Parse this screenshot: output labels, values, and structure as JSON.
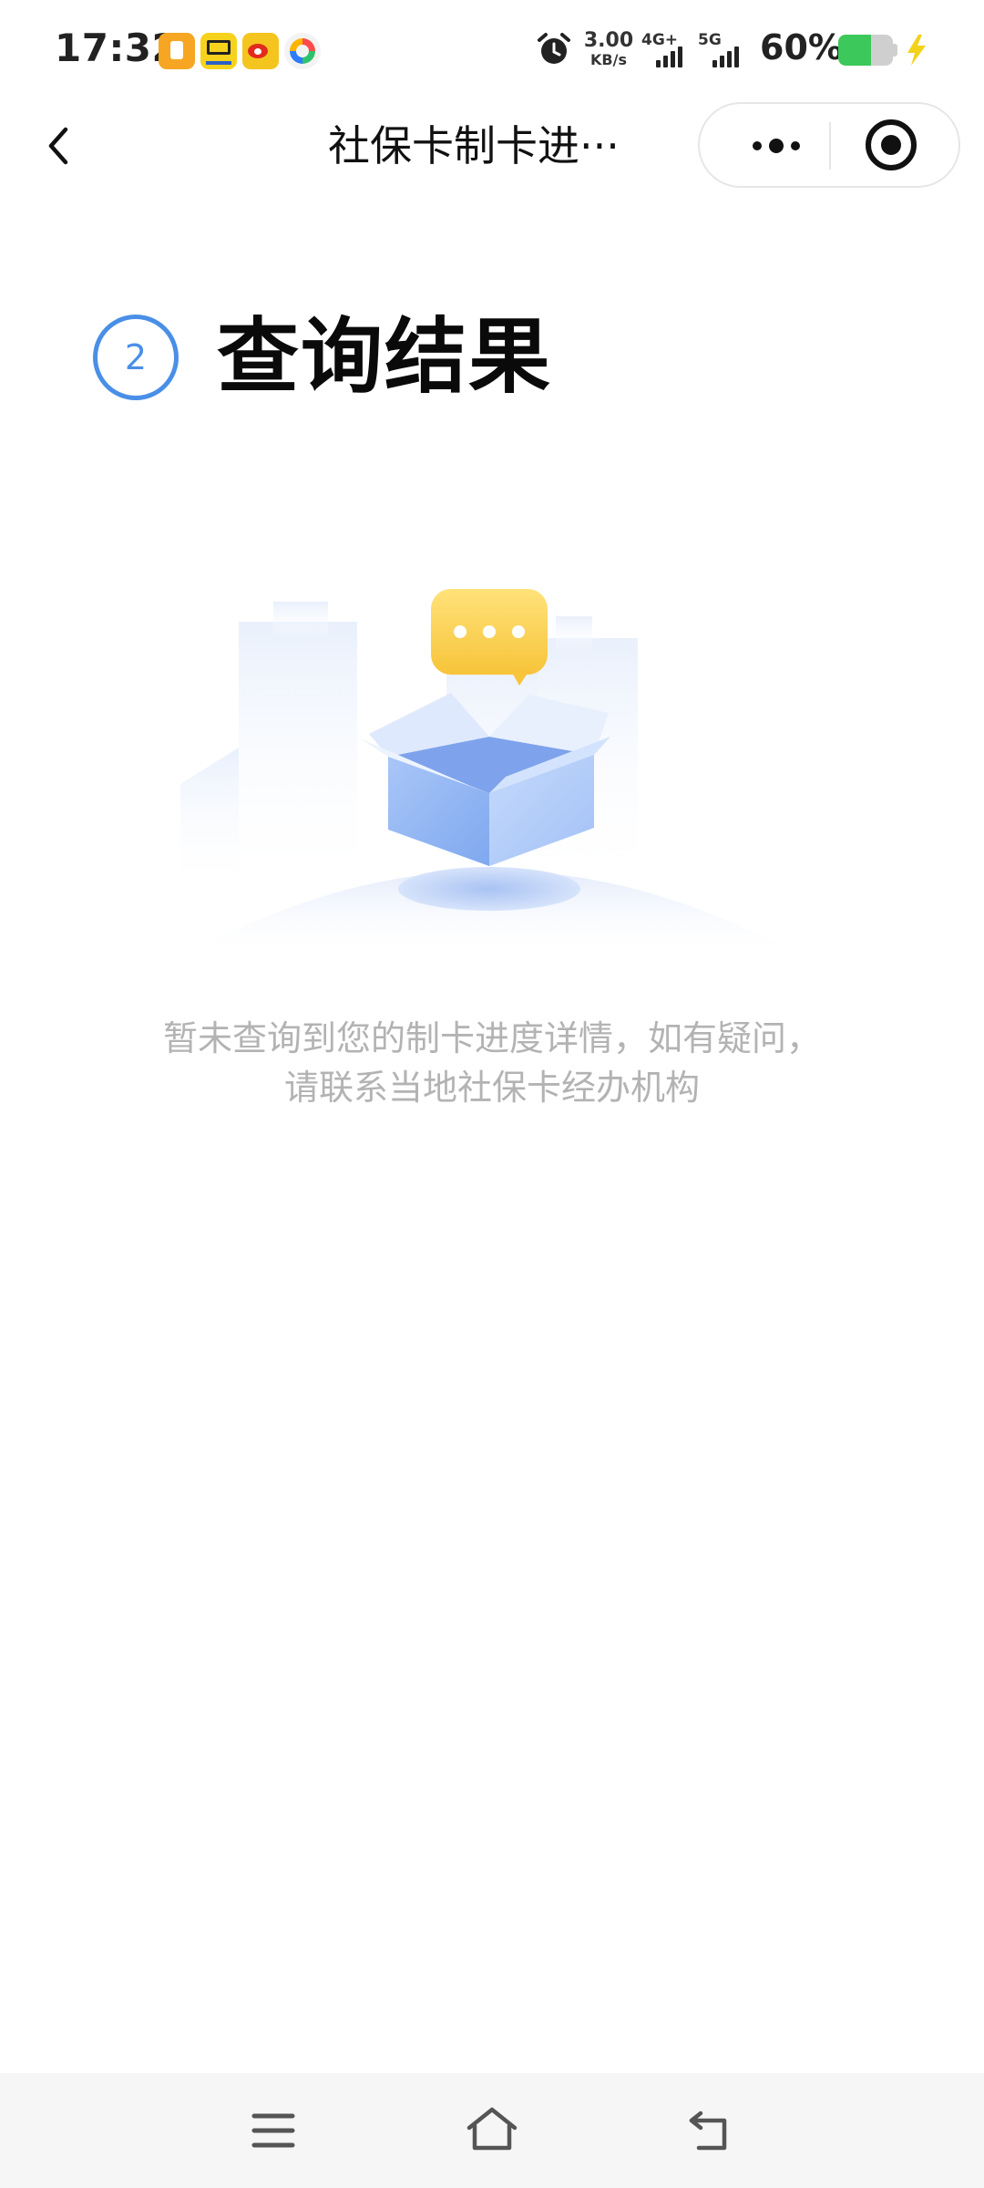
{
  "status_bar": {
    "time": "17:32",
    "net_speed_value": "3.00",
    "net_speed_unit": "KB/s",
    "network_1": "4G+",
    "network_2": "5G",
    "battery_percent": "60%",
    "battery_level": 0.6,
    "notification_icons": [
      "wallet-app-icon",
      "news-app-icon",
      "weibo-icon",
      "game-center-icon"
    ]
  },
  "nav_bar": {
    "title": "社保卡制卡进···",
    "back_icon": "chevron-left-icon",
    "more_icon": "more-dots-icon",
    "close_icon": "target-close-icon"
  },
  "step": {
    "number": "2",
    "title": "查询结果",
    "accent_color": "#4a8fe7"
  },
  "empty_state": {
    "illustration": "open-box-with-chat-bubble-illustration",
    "line1": "暂未查询到您的制卡进度详情，如有疑问，",
    "line2": "请联系当地社保卡经办机构",
    "text_color": "#b3b3b3"
  },
  "system_nav": {
    "menu_icon": "menu-icon",
    "home_icon": "home-icon",
    "back_icon": "back-icon"
  }
}
